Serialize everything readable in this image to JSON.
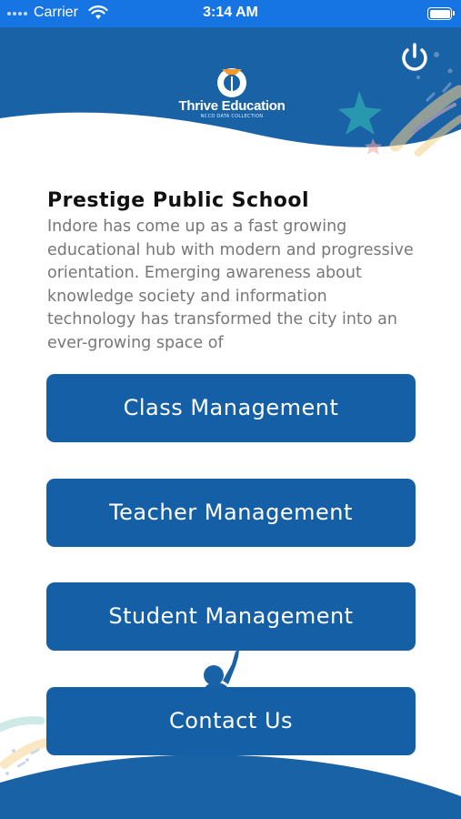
{
  "status_bar": {
    "carrier": "Carrier",
    "time": "3:14 AM"
  },
  "logo": {
    "brand": "Thrive Education",
    "tagline": "NCCD DATA COLLECTION"
  },
  "school": {
    "name": "Prestige Public School",
    "description": "Indore has come up as a fast growing educational hub with modern and progressive orientation. Emerging awareness about knowledge society and information technology has transformed the city into an ever-growing space of"
  },
  "menu": {
    "class_management": "Class Management",
    "teacher_management": "Teacher Management",
    "student_management": "Student Management",
    "contact_us": "Contact Us"
  },
  "colors": {
    "status_bar": "#1775e3",
    "header": "#1a62a6",
    "button": "#155fa6",
    "title_text": "#111111",
    "body_text": "#777777"
  },
  "icons": {
    "power": "power-icon",
    "wifi": "wifi-icon",
    "battery": "battery-icon",
    "logo": "thrive-logo-icon"
  }
}
